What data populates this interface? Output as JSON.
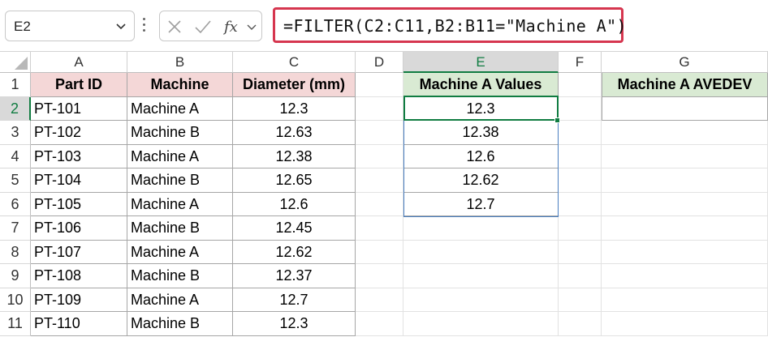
{
  "formula_bar": {
    "name_box": "E2",
    "formula": "=FILTER(C2:C11,B2:B11=\"Machine A\")",
    "icons": [
      "chevron-down-icon",
      "cancel-x-icon",
      "confirm-check-icon",
      "insert-function-icon",
      "expand-chevron-icon"
    ],
    "highlight_color": "#d6364f"
  },
  "columns": [
    "A",
    "B",
    "C",
    "D",
    "E",
    "F",
    "G"
  ],
  "selected_column": "E",
  "selected_row": "2",
  "rows": [
    "1",
    "2",
    "3",
    "4",
    "5",
    "6",
    "7",
    "8",
    "9",
    "10",
    "11"
  ],
  "table": {
    "headers": {
      "part_id": "Part ID",
      "machine": "Machine",
      "diameter": "Diameter (mm)"
    },
    "data": [
      {
        "part_id": "PT-101",
        "machine": "Machine A",
        "diameter": "12.3"
      },
      {
        "part_id": "PT-102",
        "machine": "Machine B",
        "diameter": "12.63"
      },
      {
        "part_id": "PT-103",
        "machine": "Machine A",
        "diameter": "12.38"
      },
      {
        "part_id": "PT-104",
        "machine": "Machine B",
        "diameter": "12.65"
      },
      {
        "part_id": "PT-105",
        "machine": "Machine A",
        "diameter": "12.6"
      },
      {
        "part_id": "PT-106",
        "machine": "Machine B",
        "diameter": "12.45"
      },
      {
        "part_id": "PT-107",
        "machine": "Machine A",
        "diameter": "12.62"
      },
      {
        "part_id": "PT-108",
        "machine": "Machine B",
        "diameter": "12.37"
      },
      {
        "part_id": "PT-109",
        "machine": "Machine A",
        "diameter": "12.7"
      },
      {
        "part_id": "PT-110",
        "machine": "Machine B",
        "diameter": "12.3"
      }
    ]
  },
  "filtered": {
    "header": "Machine A Values",
    "values": [
      "12.3",
      "12.38",
      "12.6",
      "12.62",
      "12.7"
    ]
  },
  "avedev": {
    "header": "Machine A AVEDEV",
    "value": ""
  },
  "colors": {
    "header_pink": "#f4d7d7",
    "header_green": "#d9ead3",
    "selection_green": "#107c41",
    "spill_blue": "#4a7fc1"
  }
}
